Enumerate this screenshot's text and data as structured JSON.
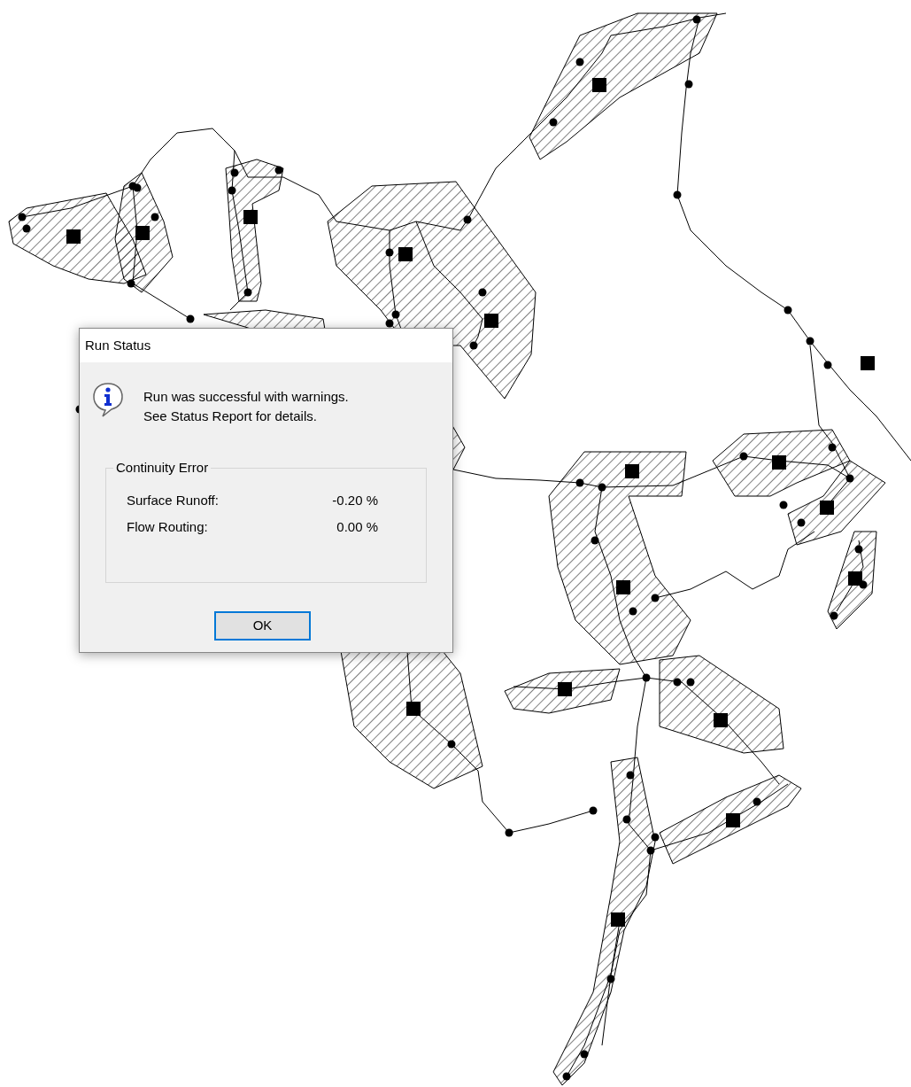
{
  "dialog": {
    "title": "Run Status",
    "message_lines": [
      "Run was successful with warnings.",
      "See Status Report for details."
    ],
    "group": {
      "title": "Continuity Error",
      "rows": [
        {
          "label": "Surface Runoff:",
          "value": "-0.20 %"
        },
        {
          "label": "Flow Routing:",
          "value": "0.00 %"
        }
      ]
    },
    "buttons": [
      {
        "label": "OK",
        "focused": true
      }
    ]
  }
}
